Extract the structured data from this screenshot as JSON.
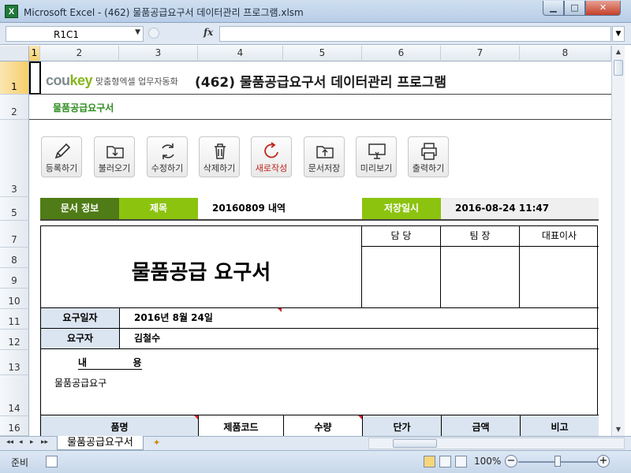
{
  "window": {
    "title": "Microsoft Excel - (462) 물품공급요구서 데이터관리 프로그램.xlsm",
    "app_icon": "X",
    "minimize": "▁",
    "maximize": "□",
    "close": "✕"
  },
  "formula_bar": {
    "name_box": "R1C1",
    "fx_label": "fx",
    "formula": ""
  },
  "columns": [
    "1",
    "2",
    "3",
    "4",
    "5",
    "6",
    "7",
    "8"
  ],
  "rows": [
    "1",
    "2",
    "3",
    "5",
    "7",
    "8",
    "9",
    "10",
    "11",
    "12",
    "13",
    "14",
    "16"
  ],
  "sheet": {
    "logo": "coukey",
    "logo_accent": "key",
    "logo_tagline": "맞춤형엑셀 업무자동화",
    "title": "(462) 물품공급요구서 데이터관리 프로그램",
    "subtitle": "물품공급요구서",
    "toolbar": [
      {
        "label": "등록하기",
        "icon": "pencil-icon"
      },
      {
        "label": "불러오기",
        "icon": "folder-download-icon"
      },
      {
        "label": "수정하기",
        "icon": "refresh-icon"
      },
      {
        "label": "삭제하기",
        "icon": "trash-icon"
      },
      {
        "label": "새로작성",
        "icon": "new-cycle-icon"
      },
      {
        "label": "문서저장",
        "icon": "folder-upload-icon"
      },
      {
        "label": "미리보기",
        "icon": "monitor-icon"
      },
      {
        "label": "출력하기",
        "icon": "printer-icon"
      }
    ],
    "info": {
      "doc_info_label": "문서 정보",
      "title_label": "제목",
      "title_value": "20160809 내역",
      "saved_label": "저장일시",
      "saved_value": "2016-08-24 11:47"
    },
    "form": {
      "heading": "물품공급 요구서",
      "approvals": [
        "담 당",
        "팀 장",
        "대표이사"
      ],
      "request_date_label": "요구일자",
      "request_date_value": "2016년 8월 24일",
      "requester_label": "요구자",
      "requester_value": "김철수",
      "content_label": "내              용",
      "content_value": "물품공급요구",
      "table_headers": [
        "품명",
        "제품코드",
        "수량",
        "단가",
        "금액",
        "비고"
      ]
    }
  },
  "tabs": {
    "sheet_name": "물품공급요구서",
    "nav": [
      "◂◂",
      "◂",
      "▸",
      "▸▸"
    ]
  },
  "status": {
    "mode": "준비",
    "zoom": "100%",
    "zoom_level_percent": 100
  }
}
